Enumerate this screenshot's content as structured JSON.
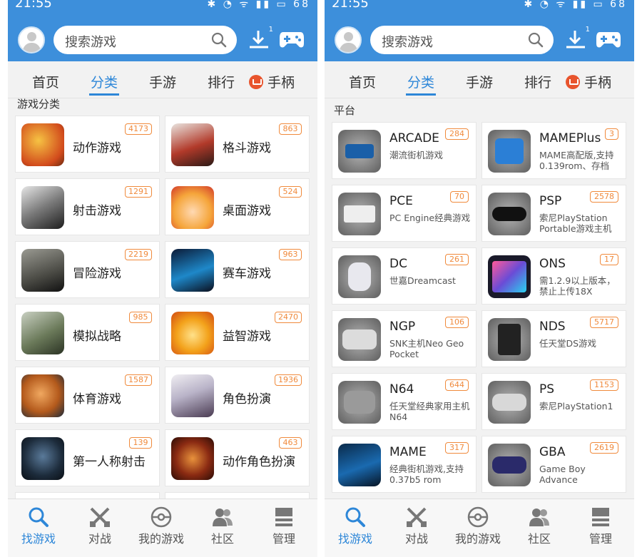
{
  "status_bar": {
    "time": "21:55",
    "battery": "68"
  },
  "search": {
    "placeholder": "搜索游戏"
  },
  "download_badge": "1",
  "tabs": [
    {
      "label": "首页"
    },
    {
      "label": "分类"
    },
    {
      "label": "手游"
    },
    {
      "label": "排行"
    },
    {
      "label": "手柄"
    }
  ],
  "left_screen": {
    "section_title": "游戏分类",
    "categories": [
      {
        "name": "动作游戏",
        "count": "4173",
        "icon": "fruit-ninja-icon"
      },
      {
        "name": "格斗游戏",
        "count": "863",
        "icon": "fighter-icon"
      },
      {
        "name": "射击游戏",
        "count": "1291",
        "icon": "soldier-icon"
      },
      {
        "name": "桌面游戏",
        "count": "524",
        "icon": "rich-game-icon"
      },
      {
        "name": "冒险游戏",
        "count": "2219",
        "icon": "resident-evil-icon"
      },
      {
        "name": "赛车游戏",
        "count": "963",
        "icon": "racing-car-icon"
      },
      {
        "name": "模拟战略",
        "count": "985",
        "icon": "mech-icon"
      },
      {
        "name": "益智游戏",
        "count": "2470",
        "icon": "cartoon-face-icon"
      },
      {
        "name": "体育游戏",
        "count": "1587",
        "icon": "basketball-icon"
      },
      {
        "name": "角色扮演",
        "count": "1936",
        "icon": "final-fantasy-icon"
      },
      {
        "name": "第一人称射击",
        "count": "139",
        "icon": "fps-soldier-icon"
      },
      {
        "name": "动作角色扮演",
        "count": "463",
        "icon": "arpg-icon"
      }
    ]
  },
  "right_screen": {
    "section_title": "平台",
    "platforms": [
      {
        "name": "ARCADE",
        "desc": "潮流街机游戏",
        "count": "284",
        "icon": "arcade-stick-icon"
      },
      {
        "name": "MAMEPlus",
        "desc": "MAME高配版,支持0.139rom、存档",
        "count": "3",
        "icon": "mameplus-icon"
      },
      {
        "name": "PCE",
        "desc": "PC Engine经典游戏",
        "count": "70",
        "icon": "pce-console-icon"
      },
      {
        "name": "PSP",
        "desc": "索尼PlayStation Portable游戏主机",
        "count": "2578",
        "icon": "psp-icon"
      },
      {
        "name": "DC",
        "desc": "世嘉Dreamcast",
        "count": "261",
        "icon": "dreamcast-controller-icon"
      },
      {
        "name": "ONS",
        "desc": "需1.2.9以上版本，禁止上传18X",
        "count": "17",
        "icon": "ons-icon"
      },
      {
        "name": "NGP",
        "desc": "SNK主机Neo Geo Pocket",
        "count": "106",
        "icon": "ngp-icon"
      },
      {
        "name": "NDS",
        "desc": "任天堂DS游戏",
        "count": "5717",
        "icon": "nds-icon"
      },
      {
        "name": "N64",
        "desc": "任天堂经典家用主机N64",
        "count": "644",
        "icon": "n64-controller-icon"
      },
      {
        "name": "PS",
        "desc": "索尼PlayStation1",
        "count": "1153",
        "icon": "ps1-controller-icon"
      },
      {
        "name": "MAME",
        "desc": "经典街机游戏,支持0.37b5 rom",
        "count": "317",
        "icon": "mame-icon"
      },
      {
        "name": "GBA",
        "desc": "Game Boy Advance",
        "count": "2619",
        "icon": "gba-icon"
      }
    ]
  },
  "bottom_nav": [
    {
      "label": "找游戏"
    },
    {
      "label": "对战"
    },
    {
      "label": "我的游戏"
    },
    {
      "label": "社区"
    },
    {
      "label": "管理"
    }
  ],
  "colors": {
    "primary": "#3d8fdb",
    "accent": "#2e87d8",
    "badge": "#f08a3c"
  }
}
